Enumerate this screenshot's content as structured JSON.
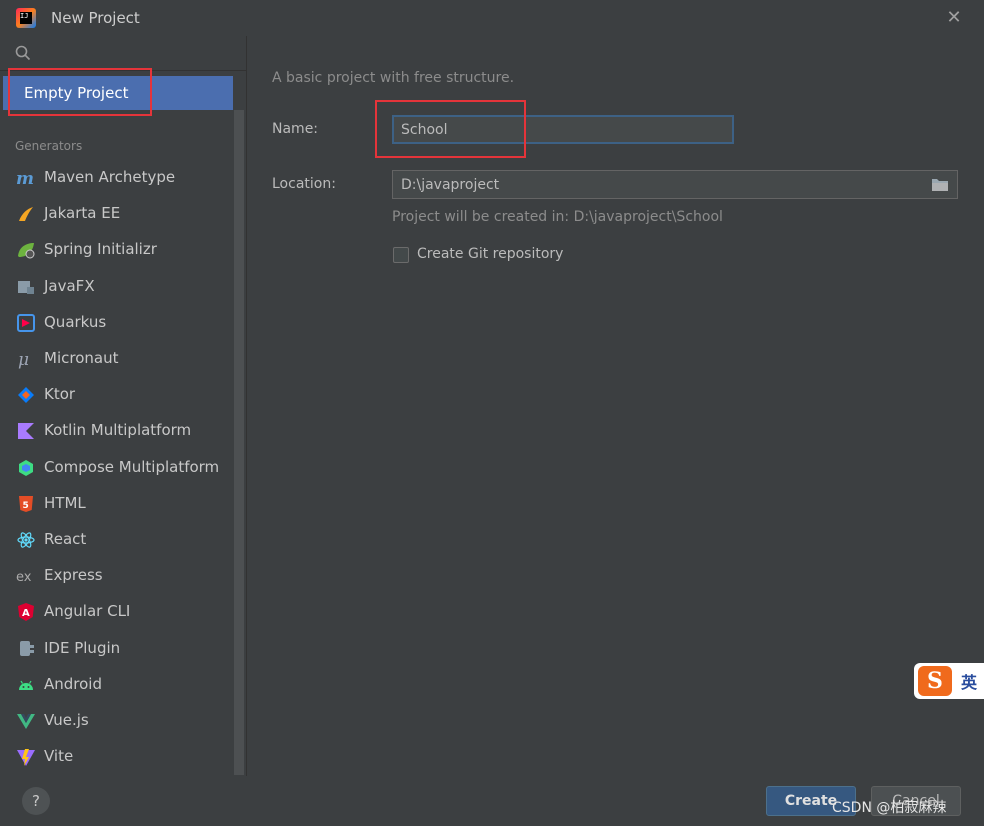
{
  "window": {
    "title": "New Project"
  },
  "sidebar": {
    "selected": "Empty Project",
    "section_label": "Generators",
    "generators": [
      {
        "label": "Maven Archetype",
        "icon": "maven-icon"
      },
      {
        "label": "Jakarta EE",
        "icon": "jakarta-icon"
      },
      {
        "label": "Spring Initializr",
        "icon": "spring-icon"
      },
      {
        "label": "JavaFX",
        "icon": "javafx-icon"
      },
      {
        "label": "Quarkus",
        "icon": "quarkus-icon"
      },
      {
        "label": "Micronaut",
        "icon": "micronaut-icon"
      },
      {
        "label": "Ktor",
        "icon": "ktor-icon"
      },
      {
        "label": "Kotlin Multiplatform",
        "icon": "kotlin-icon"
      },
      {
        "label": "Compose Multiplatform",
        "icon": "compose-icon"
      },
      {
        "label": "HTML",
        "icon": "html5-icon"
      },
      {
        "label": "React",
        "icon": "react-icon"
      },
      {
        "label": "Express",
        "icon": "express-icon"
      },
      {
        "label": "Angular CLI",
        "icon": "angular-icon"
      },
      {
        "label": "IDE Plugin",
        "icon": "plugin-icon"
      },
      {
        "label": "Android",
        "icon": "android-icon"
      },
      {
        "label": "Vue.js",
        "icon": "vue-icon"
      },
      {
        "label": "Vite",
        "icon": "vite-icon"
      }
    ]
  },
  "form": {
    "description": "A basic project with free structure.",
    "name_label": "Name:",
    "name_value": "School",
    "location_label": "Location:",
    "location_value": "D:\\javaproject",
    "hint": "Project will be created in: D:\\javaproject\\School",
    "git_checkbox_label": "Create Git repository",
    "git_checked": false
  },
  "buttons": {
    "create": "Create",
    "cancel": "Cancel",
    "help": "?"
  },
  "overlay": {
    "watermark": "CSDN @柏寂麻辣",
    "ime_logo": "S",
    "ime_text": "英"
  },
  "colors": {
    "background": "#3c3f41",
    "selection": "#4b6eaf",
    "highlight_box": "#e5343a",
    "primary_button": "#365880"
  }
}
